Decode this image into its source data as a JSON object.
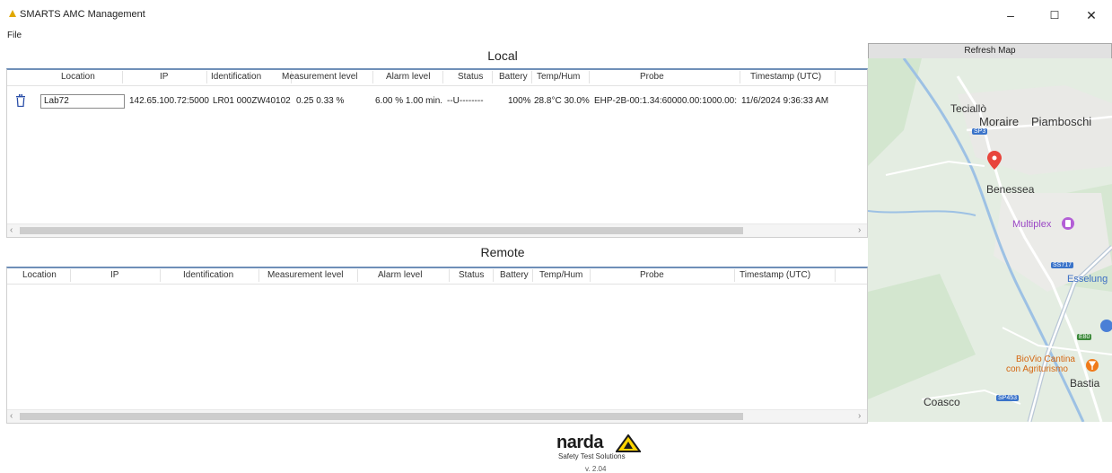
{
  "window": {
    "title": "SMARTS AMC Management",
    "minimize": "–",
    "maximize": "☐",
    "close": "✕"
  },
  "menu": {
    "file": "File"
  },
  "local": {
    "title": "Local",
    "columns": [
      "Location",
      "IP",
      "Identification",
      "Measurement level",
      "Alarm level",
      "Status",
      "Battery",
      "Temp/Hum",
      "Probe",
      "Timestamp (UTC)"
    ],
    "rows": [
      {
        "location": "Lab72",
        "ip": "142.65.100.72:5000",
        "identification": "LR01 000ZW40102",
        "measurement": "0.25 0.33  %",
        "alarm": "6.00 % 1.00 min.",
        "status": "--U--------",
        "battery": "100%",
        "temphum": "28.8°C 30.0%",
        "probe": "EHP-2B-00:1.34:60000.00:1000.00:",
        "timestamp": "11/6/2024 9:36:33 AM"
      }
    ]
  },
  "remote": {
    "title": "Remote",
    "columns": [
      "Location",
      "IP",
      "Identification",
      "Measurement level",
      "Alarm level",
      "Status",
      "Battery",
      "Temp/Hum",
      "Probe",
      "Timestamp (UTC)"
    ]
  },
  "map": {
    "refresh_label": "Refresh Map",
    "labels": {
      "teciallo": "Teciallò",
      "moraire": "Moraire",
      "piamboschi": "Piamboschi",
      "benessea": "Benessea",
      "multiplex": "Multiplex",
      "esselunga": "Esselung",
      "biovio1": "BioVio Cantina",
      "biovio2": "con Agriturismo",
      "bastia": "Bastia",
      "coasco": "Coasco"
    },
    "roads": {
      "sp3": "SP3",
      "ss717": "SS717",
      "e80": "E80",
      "sp453": "SP453"
    },
    "colors": {
      "land": "#e6efe4",
      "water": "#8ab4dc",
      "road": "#ffffff",
      "pin": "#e8453c",
      "poi": "#b35fd6"
    }
  },
  "footer": {
    "brand": "narda",
    "subtitle": "Safety Test Solutions",
    "version": "v. 2.04"
  }
}
